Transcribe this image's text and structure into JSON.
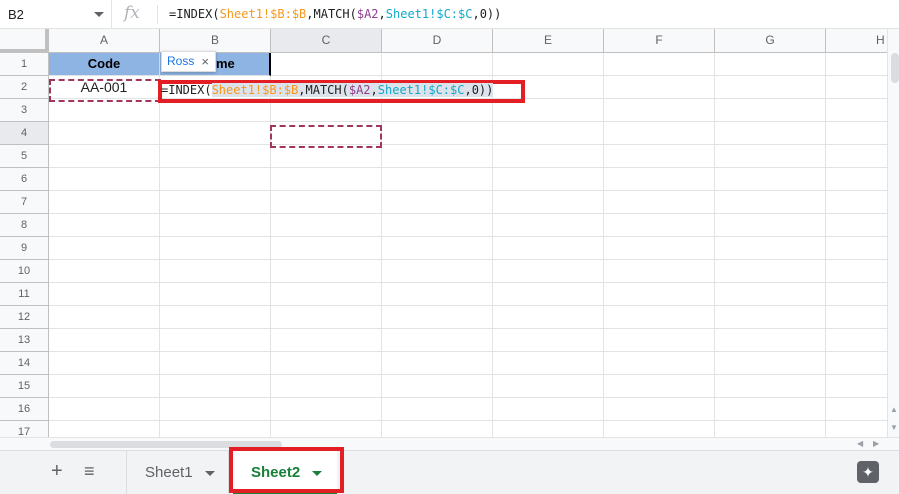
{
  "formula_bar": {
    "name_box": "B2",
    "fx_label": "fx",
    "formula": {
      "p1": "=INDEX(",
      "p2": "Sheet1!$B:$B",
      "p3": ",MATCH(",
      "p4": "$A2",
      "p5": ",",
      "p6": "Sheet1!$C:$C",
      "p7": ",0))"
    }
  },
  "columns": [
    "A",
    "B",
    "C",
    "D",
    "E",
    "F",
    "G",
    "H"
  ],
  "rows": [
    "1",
    "2",
    "3",
    "4",
    "5",
    "6",
    "7",
    "8",
    "9",
    "10",
    "11",
    "12",
    "13",
    "14",
    "15",
    "16",
    "17"
  ],
  "cells": {
    "a1": "Code",
    "b1_tail": "me",
    "a2": "AA-001"
  },
  "tooltip": {
    "suggestion": "Ross",
    "close": "×"
  },
  "sheets": {
    "add": "+",
    "all": "≡",
    "tab1": "Sheet1",
    "tab2": "Sheet2",
    "explore": "✦"
  },
  "colors": {
    "header_fill": "#8eb4e3",
    "highlight_box": "#e31e24",
    "active_tab": "#188038",
    "copy_border": "#a0365f"
  }
}
